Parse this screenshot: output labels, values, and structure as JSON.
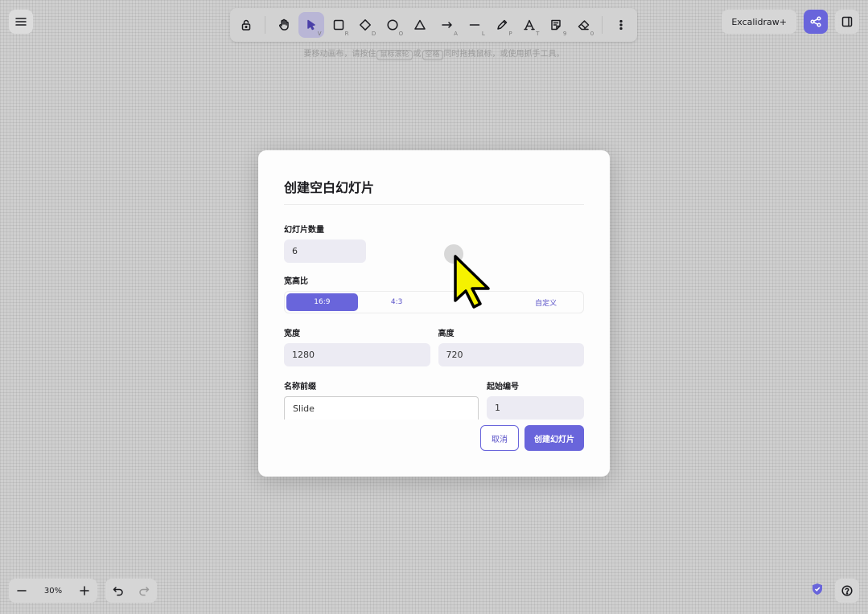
{
  "toolbar": {
    "tools": [
      {
        "name": "lock",
        "key": ""
      },
      {
        "name": "hand",
        "key": ""
      },
      {
        "name": "selection",
        "key": "V"
      },
      {
        "name": "rectangle",
        "key": "R"
      },
      {
        "name": "diamond",
        "key": "D"
      },
      {
        "name": "ellipse",
        "key": "O"
      },
      {
        "name": "triangle",
        "key": ""
      },
      {
        "name": "arrow",
        "key": "A"
      },
      {
        "name": "line",
        "key": "L"
      },
      {
        "name": "draw",
        "key": "P"
      },
      {
        "name": "text",
        "key": "T"
      },
      {
        "name": "image",
        "key": "9"
      },
      {
        "name": "eraser",
        "key": "0"
      }
    ]
  },
  "hint": {
    "part1": "要移动画布，请按住",
    "key1": "鼠标滚轮",
    "part2": "或",
    "key2": "空格",
    "part3": "同时拖拽鼠标，或使用抓手工具。"
  },
  "header": {
    "excalidraw_plus": "Excalidraw+"
  },
  "footer": {
    "zoom": "30%"
  },
  "dialog": {
    "title": "创建空白幻灯片",
    "count_label": "幻灯片数量",
    "count_value": "6",
    "aspect_label": "宽高比",
    "aspect_options": [
      "16:9",
      "4:3",
      "",
      "自定义"
    ],
    "width_label": "宽度",
    "width_value": "1280",
    "height_label": "高度",
    "height_value": "720",
    "prefix_label": "名称前缀",
    "prefix_value": "Slide",
    "start_label": "起始编号",
    "start_value": "1",
    "cancel": "取消",
    "create": "创建幻灯片"
  },
  "colors": {
    "accent": "#6965db",
    "cursor": "#f5f200"
  }
}
